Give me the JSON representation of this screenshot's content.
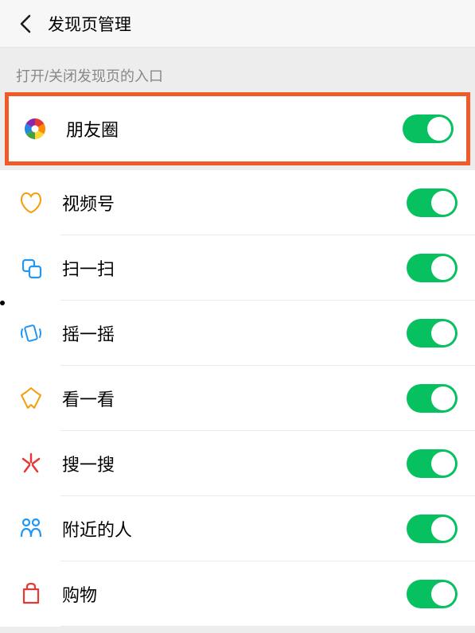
{
  "header": {
    "title": "发现页管理"
  },
  "section_label": "打开/关闭发现页的入口",
  "items": [
    {
      "label": "朋友圈",
      "toggled": true,
      "highlighted": true
    },
    {
      "label": "视频号",
      "toggled": true
    },
    {
      "label": "扫一扫",
      "toggled": true
    },
    {
      "label": "摇一摇",
      "toggled": true
    },
    {
      "label": "看一看",
      "toggled": true
    },
    {
      "label": "搜一搜",
      "toggled": true
    },
    {
      "label": "附近的人",
      "toggled": true
    },
    {
      "label": "购物",
      "toggled": true
    }
  ]
}
